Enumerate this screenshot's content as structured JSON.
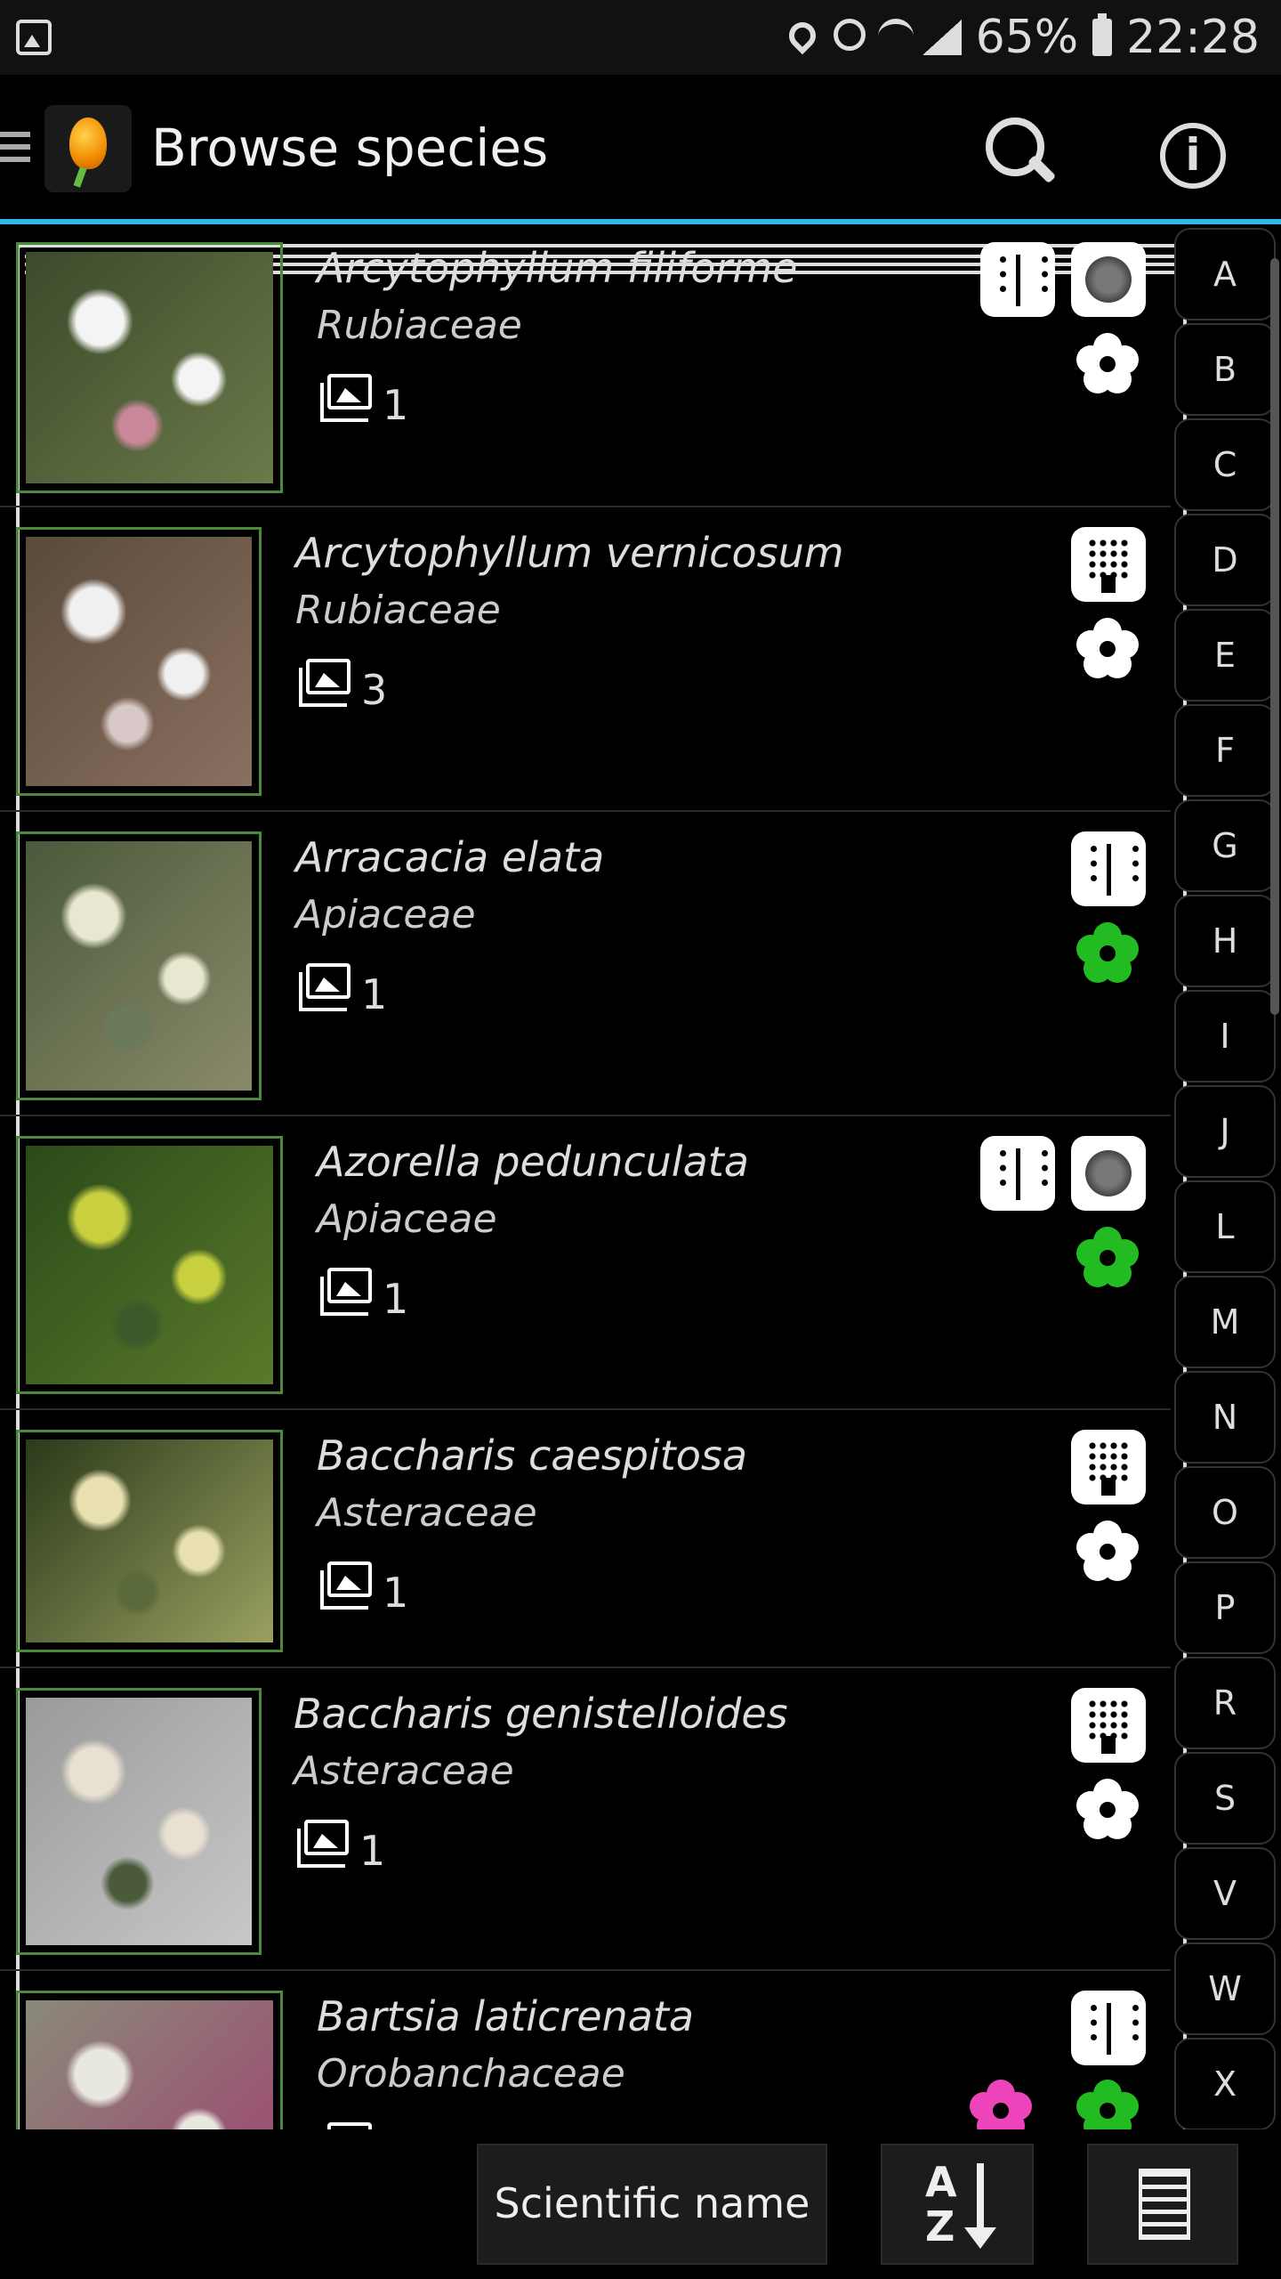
{
  "status_bar": {
    "battery": "65%",
    "time": "22:28"
  },
  "app_bar": {
    "title": "Browse species"
  },
  "species": [
    {
      "name": "Arcytophyllum filiforme",
      "family": "Rubiaceae",
      "photos": "1",
      "badges": [
        "leaf-icon",
        "flower-cluster-icon"
      ],
      "flowers": [
        "white"
      ],
      "thumb_colors": [
        "#3c4a2a",
        "#6a7a4a",
        "#f4f4f4",
        "#c8889a"
      ]
    },
    {
      "name": "Arcytophyllum vernicosum",
      "family": "Rubiaceae",
      "photos": "3",
      "badges": [
        "inflorescence-icon"
      ],
      "flowers": [
        "white"
      ],
      "thumb_colors": [
        "#5a4a3a",
        "#8a7060",
        "#f0f0f0",
        "#d8c8c8"
      ]
    },
    {
      "name": "Arracacia elata",
      "family": "Apiaceae",
      "photos": "1",
      "badges": [
        "leaf-icon"
      ],
      "flowers": [
        "green"
      ],
      "thumb_colors": [
        "#4a5a3a",
        "#8a8a6a",
        "#e8e8d0",
        "#6a7a5a"
      ]
    },
    {
      "name": "Azorella pedunculata",
      "family": "Apiaceae",
      "photos": "1",
      "badges": [
        "leaf-icon",
        "flower-cluster-icon"
      ],
      "flowers": [
        "green"
      ],
      "thumb_colors": [
        "#2a4a1a",
        "#5a7a2a",
        "#c8d040",
        "#3a5a2a"
      ]
    },
    {
      "name": "Baccharis caespitosa",
      "family": "Asteraceae",
      "photos": "1",
      "badges": [
        "inflorescence-icon"
      ],
      "flowers": [
        "white"
      ],
      "thumb_colors": [
        "#2a3a1a",
        "#9aa060",
        "#e8e0b0",
        "#5a6a3a"
      ]
    },
    {
      "name": "Baccharis genistelloides",
      "family": "Asteraceae",
      "photos": "1",
      "badges": [
        "inflorescence-icon"
      ],
      "flowers": [
        "white"
      ],
      "thumb_colors": [
        "#9a9a9a",
        "#c8c8c8",
        "#e8e0d0",
        "#4a5a3a"
      ]
    },
    {
      "name": "Bartsia laticrenata",
      "family": "Orobanchaceae",
      "photos": "",
      "badges": [
        "leaf-icon"
      ],
      "flowers": [
        "pink",
        "green"
      ],
      "thumb_colors": [
        "#8a8a7a",
        "#a04070",
        "#e8e8e0",
        "#6a6a5a"
      ]
    }
  ],
  "index_letters": [
    "A",
    "B",
    "C",
    "D",
    "E",
    "F",
    "G",
    "H",
    "I",
    "J",
    "L",
    "M",
    "N",
    "O",
    "P",
    "R",
    "S",
    "V",
    "W",
    "X"
  ],
  "bottom_bar": {
    "sort_label": "Scientific name",
    "az_a": "A",
    "az_z": "Z"
  },
  "colors": {
    "accent": "#33b5e5",
    "thumb_border": "#4a8a3a",
    "flower_white": "#ffffff",
    "flower_green": "#22bb22",
    "flower_pink": "#ee44bb"
  }
}
